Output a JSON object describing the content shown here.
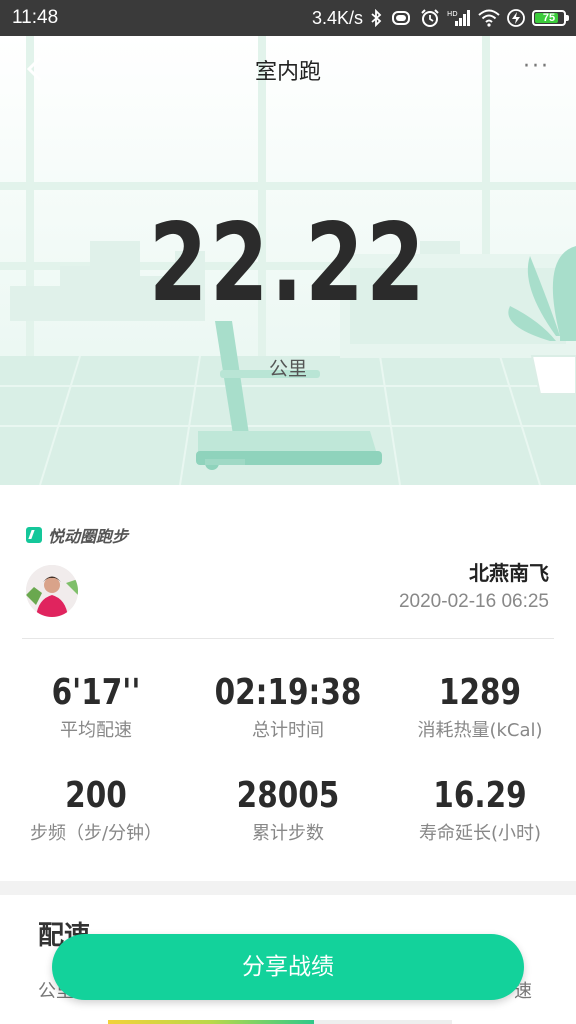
{
  "status_bar": {
    "time": "11:48",
    "network_speed": "3.4K/s",
    "battery": "75",
    "icons": [
      "bluetooth-icon",
      "vibrate-icon",
      "alarm-icon",
      "hd-signal-icon",
      "wifi-icon",
      "charging-icon",
      "battery-icon"
    ]
  },
  "header": {
    "title": "室内跑",
    "back_icon": "chevron-left-icon",
    "more_icon": "more-dots-icon",
    "more_label": "···"
  },
  "hero": {
    "distance": "22.22",
    "unit": "公里"
  },
  "brand": {
    "name": "悦动圈跑步",
    "logo_icon": "brand-logo-icon"
  },
  "user": {
    "name": "北燕南飞",
    "datetime": "2020-02-16 06:25"
  },
  "stats": [
    {
      "value": "6'17''",
      "label": "平均配速"
    },
    {
      "value": "02:19:38",
      "label": "总计时间"
    },
    {
      "value": "1289",
      "label": "消耗热量(kCal)"
    },
    {
      "value": "200",
      "label": "步频（步/分钟）"
    },
    {
      "value": "28005",
      "label": "累计步数"
    },
    {
      "value": "16.29",
      "label": "寿命延长(小时)"
    }
  ],
  "pace": {
    "title": "配速",
    "left_header": "公里",
    "right_header": "速",
    "first_bar_fraction": 0.6
  },
  "share_button": "分享战绩",
  "colors": {
    "accent": "#13d29b",
    "status_bar": "#3a3a3a"
  }
}
